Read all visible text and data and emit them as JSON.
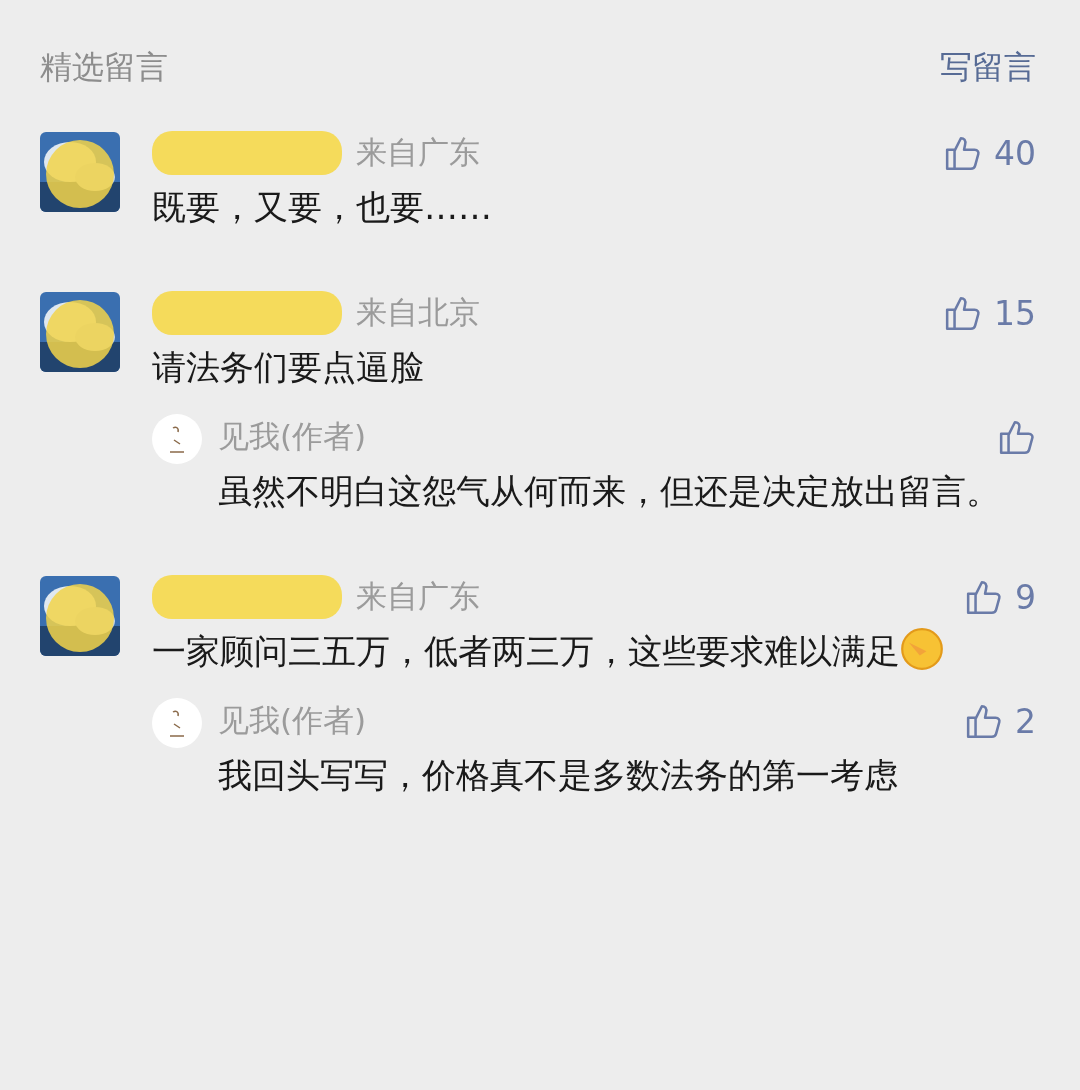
{
  "header": {
    "title": "精选留言",
    "write_link": "写留言"
  },
  "comments": [
    {
      "name_redacted": true,
      "location": "来自广东",
      "text": "既要，又要，也要……",
      "likes": "40",
      "emoji": false
    },
    {
      "name_redacted": true,
      "location": "来自北京",
      "text": "请法务们要点逼脸",
      "likes": "15",
      "emoji": false,
      "reply": {
        "author": "见我(作者)",
        "text": "虽然不明白这怨气从何而来，但还是决定放出留言。"
      }
    },
    {
      "name_redacted": true,
      "location": "来自广东",
      "text": "一家顾问三五万，低者两三万，这些要求难以满足",
      "likes": "9",
      "emoji": true,
      "reply": {
        "author": "见我(作者)",
        "text": "我回头写写，价格真不是多数法务的第一考虑",
        "likes": "2"
      }
    }
  ]
}
